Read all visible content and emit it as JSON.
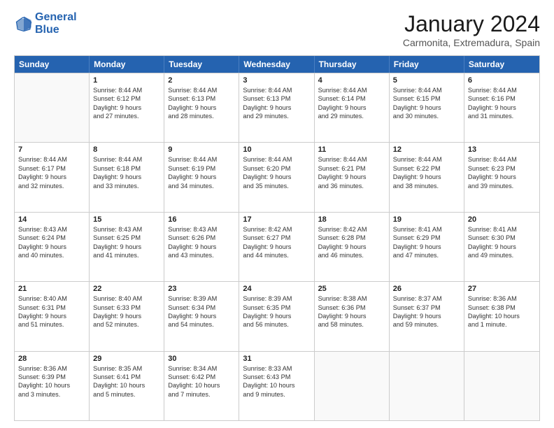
{
  "header": {
    "logo_text1": "General",
    "logo_text2": "Blue",
    "month_year": "January 2024",
    "location": "Carmonita, Extremadura, Spain"
  },
  "calendar": {
    "days": [
      "Sunday",
      "Monday",
      "Tuesday",
      "Wednesday",
      "Thursday",
      "Friday",
      "Saturday"
    ],
    "rows": [
      [
        {
          "day": "",
          "sunrise": "",
          "sunset": "",
          "daylight": ""
        },
        {
          "day": "1",
          "sunrise": "Sunrise: 8:44 AM",
          "sunset": "Sunset: 6:12 PM",
          "daylight": "Daylight: 9 hours and 27 minutes."
        },
        {
          "day": "2",
          "sunrise": "Sunrise: 8:44 AM",
          "sunset": "Sunset: 6:13 PM",
          "daylight": "Daylight: 9 hours and 28 minutes."
        },
        {
          "day": "3",
          "sunrise": "Sunrise: 8:44 AM",
          "sunset": "Sunset: 6:13 PM",
          "daylight": "Daylight: 9 hours and 29 minutes."
        },
        {
          "day": "4",
          "sunrise": "Sunrise: 8:44 AM",
          "sunset": "Sunset: 6:14 PM",
          "daylight": "Daylight: 9 hours and 29 minutes."
        },
        {
          "day": "5",
          "sunrise": "Sunrise: 8:44 AM",
          "sunset": "Sunset: 6:15 PM",
          "daylight": "Daylight: 9 hours and 30 minutes."
        },
        {
          "day": "6",
          "sunrise": "Sunrise: 8:44 AM",
          "sunset": "Sunset: 6:16 PM",
          "daylight": "Daylight: 9 hours and 31 minutes."
        }
      ],
      [
        {
          "day": "7",
          "sunrise": "Sunrise: 8:44 AM",
          "sunset": "Sunset: 6:17 PM",
          "daylight": "Daylight: 9 hours and 32 minutes."
        },
        {
          "day": "8",
          "sunrise": "Sunrise: 8:44 AM",
          "sunset": "Sunset: 6:18 PM",
          "daylight": "Daylight: 9 hours and 33 minutes."
        },
        {
          "day": "9",
          "sunrise": "Sunrise: 8:44 AM",
          "sunset": "Sunset: 6:19 PM",
          "daylight": "Daylight: 9 hours and 34 minutes."
        },
        {
          "day": "10",
          "sunrise": "Sunrise: 8:44 AM",
          "sunset": "Sunset: 6:20 PM",
          "daylight": "Daylight: 9 hours and 35 minutes."
        },
        {
          "day": "11",
          "sunrise": "Sunrise: 8:44 AM",
          "sunset": "Sunset: 6:21 PM",
          "daylight": "Daylight: 9 hours and 36 minutes."
        },
        {
          "day": "12",
          "sunrise": "Sunrise: 8:44 AM",
          "sunset": "Sunset: 6:22 PM",
          "daylight": "Daylight: 9 hours and 38 minutes."
        },
        {
          "day": "13",
          "sunrise": "Sunrise: 8:44 AM",
          "sunset": "Sunset: 6:23 PM",
          "daylight": "Daylight: 9 hours and 39 minutes."
        }
      ],
      [
        {
          "day": "14",
          "sunrise": "Sunrise: 8:43 AM",
          "sunset": "Sunset: 6:24 PM",
          "daylight": "Daylight: 9 hours and 40 minutes."
        },
        {
          "day": "15",
          "sunrise": "Sunrise: 8:43 AM",
          "sunset": "Sunset: 6:25 PM",
          "daylight": "Daylight: 9 hours and 41 minutes."
        },
        {
          "day": "16",
          "sunrise": "Sunrise: 8:43 AM",
          "sunset": "Sunset: 6:26 PM",
          "daylight": "Daylight: 9 hours and 43 minutes."
        },
        {
          "day": "17",
          "sunrise": "Sunrise: 8:42 AM",
          "sunset": "Sunset: 6:27 PM",
          "daylight": "Daylight: 9 hours and 44 minutes."
        },
        {
          "day": "18",
          "sunrise": "Sunrise: 8:42 AM",
          "sunset": "Sunset: 6:28 PM",
          "daylight": "Daylight: 9 hours and 46 minutes."
        },
        {
          "day": "19",
          "sunrise": "Sunrise: 8:41 AM",
          "sunset": "Sunset: 6:29 PM",
          "daylight": "Daylight: 9 hours and 47 minutes."
        },
        {
          "day": "20",
          "sunrise": "Sunrise: 8:41 AM",
          "sunset": "Sunset: 6:30 PM",
          "daylight": "Daylight: 9 hours and 49 minutes."
        }
      ],
      [
        {
          "day": "21",
          "sunrise": "Sunrise: 8:40 AM",
          "sunset": "Sunset: 6:31 PM",
          "daylight": "Daylight: 9 hours and 51 minutes."
        },
        {
          "day": "22",
          "sunrise": "Sunrise: 8:40 AM",
          "sunset": "Sunset: 6:33 PM",
          "daylight": "Daylight: 9 hours and 52 minutes."
        },
        {
          "day": "23",
          "sunrise": "Sunrise: 8:39 AM",
          "sunset": "Sunset: 6:34 PM",
          "daylight": "Daylight: 9 hours and 54 minutes."
        },
        {
          "day": "24",
          "sunrise": "Sunrise: 8:39 AM",
          "sunset": "Sunset: 6:35 PM",
          "daylight": "Daylight: 9 hours and 56 minutes."
        },
        {
          "day": "25",
          "sunrise": "Sunrise: 8:38 AM",
          "sunset": "Sunset: 6:36 PM",
          "daylight": "Daylight: 9 hours and 58 minutes."
        },
        {
          "day": "26",
          "sunrise": "Sunrise: 8:37 AM",
          "sunset": "Sunset: 6:37 PM",
          "daylight": "Daylight: 9 hours and 59 minutes."
        },
        {
          "day": "27",
          "sunrise": "Sunrise: 8:36 AM",
          "sunset": "Sunset: 6:38 PM",
          "daylight": "Daylight: 10 hours and 1 minute."
        }
      ],
      [
        {
          "day": "28",
          "sunrise": "Sunrise: 8:36 AM",
          "sunset": "Sunset: 6:39 PM",
          "daylight": "Daylight: 10 hours and 3 minutes."
        },
        {
          "day": "29",
          "sunrise": "Sunrise: 8:35 AM",
          "sunset": "Sunset: 6:41 PM",
          "daylight": "Daylight: 10 hours and 5 minutes."
        },
        {
          "day": "30",
          "sunrise": "Sunrise: 8:34 AM",
          "sunset": "Sunset: 6:42 PM",
          "daylight": "Daylight: 10 hours and 7 minutes."
        },
        {
          "day": "31",
          "sunrise": "Sunrise: 8:33 AM",
          "sunset": "Sunset: 6:43 PM",
          "daylight": "Daylight: 10 hours and 9 minutes."
        },
        {
          "day": "",
          "sunrise": "",
          "sunset": "",
          "daylight": ""
        },
        {
          "day": "",
          "sunrise": "",
          "sunset": "",
          "daylight": ""
        },
        {
          "day": "",
          "sunrise": "",
          "sunset": "",
          "daylight": ""
        }
      ]
    ]
  }
}
